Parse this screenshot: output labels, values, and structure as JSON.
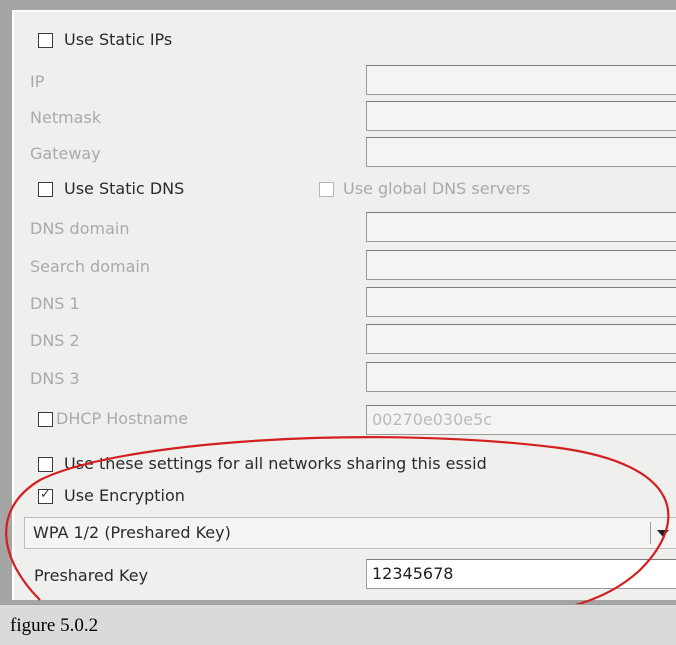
{
  "static_ips": {
    "label": "Use Static IPs",
    "checked": false
  },
  "ip_fields": [
    {
      "label": "IP",
      "value": ""
    },
    {
      "label": "Netmask",
      "value": ""
    },
    {
      "label": "Gateway",
      "value": ""
    }
  ],
  "static_dns": {
    "label": "Use Static DNS",
    "checked": false
  },
  "global_dns": {
    "label": "Use global DNS servers",
    "checked": false
  },
  "dns_fields": [
    {
      "label": "DNS domain",
      "value": ""
    },
    {
      "label": "Search domain",
      "value": ""
    },
    {
      "label": "DNS 1",
      "value": ""
    },
    {
      "label": "DNS 2",
      "value": ""
    },
    {
      "label": "DNS 3",
      "value": ""
    }
  ],
  "dhcp_hostname": {
    "label": "DHCP Hostname",
    "value": "00270e030e5c",
    "checked": false
  },
  "share_settings": {
    "label": "Use these settings for all networks sharing this essid",
    "checked": false
  },
  "encryption": {
    "label": "Use Encryption",
    "checked": true
  },
  "encryption_type": {
    "selected": "WPA 1/2 (Preshared Key)"
  },
  "preshared_key": {
    "label": "Preshared Key",
    "value": "12345678"
  },
  "caption": "figure 5.0.2",
  "colors": {
    "highlight_ellipse": "#d22020",
    "panel": "#efefee"
  }
}
